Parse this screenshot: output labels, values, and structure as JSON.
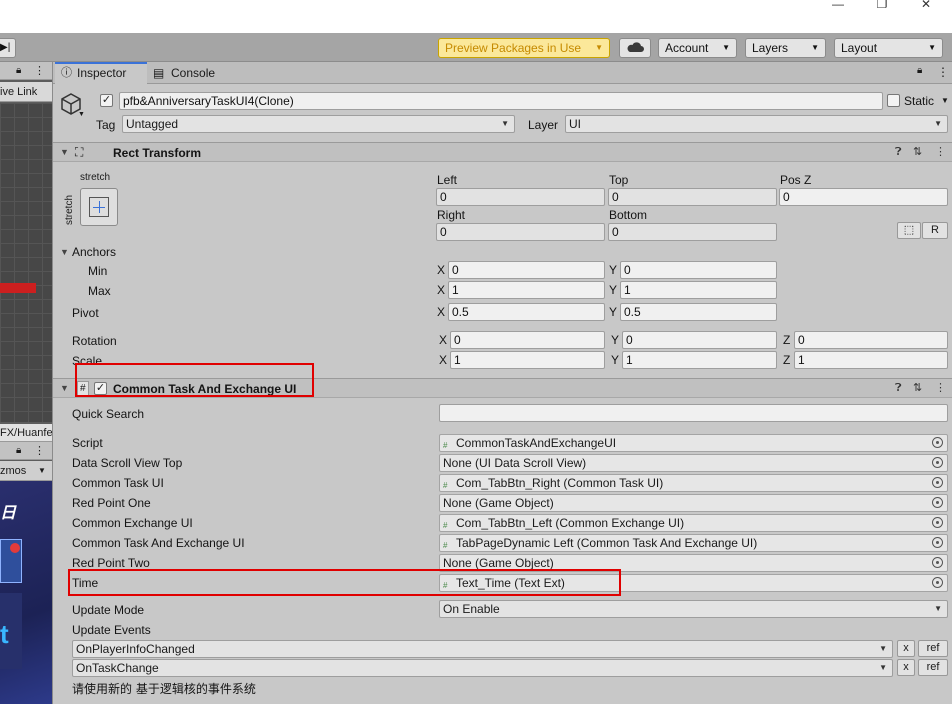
{
  "window": {
    "minimize_glyph": "—",
    "restore_glyph": "❐",
    "close_glyph": "✕"
  },
  "toolbar": {
    "play_glyph": "▶|",
    "preview_packages": "Preview Packages in Use",
    "cloud_icon": "cloud-icon",
    "account": "Account",
    "layers": "Layers",
    "layout": "Layout"
  },
  "left_panel": {
    "header1_text": "ive Link",
    "path_text": "FX/Huanfe",
    "gizmos_text": "zmos",
    "game_char": "日",
    "game_char2": "t"
  },
  "tabs": {
    "inspector": "Inspector",
    "console": "Console"
  },
  "object": {
    "name": "pfb&AnniversaryTaskUI4(Clone)",
    "static_label": "Static",
    "tag_label": "Tag",
    "tag_value": "Untagged",
    "layer_label": "Layer",
    "layer_value": "UI"
  },
  "rect_transform": {
    "title": "Rect Transform",
    "anchor_preset_h": "stretch",
    "anchor_preset_v": "stretch",
    "left_label": "Left",
    "left_value": "0",
    "top_label": "Top",
    "top_value": "0",
    "posz_label": "Pos Z",
    "posz_value": "0",
    "right_label": "Right",
    "right_value": "0",
    "bottom_label": "Bottom",
    "bottom_value": "0",
    "r_button": "R",
    "anchors_label": "Anchors",
    "min_label": "Min",
    "min_x": "0",
    "min_y": "0",
    "max_label": "Max",
    "max_x": "1",
    "max_y": "1",
    "pivot_label": "Pivot",
    "pivot_x": "0.5",
    "pivot_y": "0.5",
    "rotation_label": "Rotation",
    "rot_x": "0",
    "rot_y": "0",
    "rot_z": "0",
    "scale_label": "Scale",
    "scale_x": "1",
    "scale_y": "1",
    "scale_z": "1",
    "x": "X",
    "y": "Y",
    "z": "Z"
  },
  "component": {
    "title": "Common Task And Exchange UI",
    "hash": "#",
    "quick_search_label": "Quick Search",
    "quick_search_value": "",
    "fields": [
      {
        "label": "Script",
        "value": "CommonTaskAndExchangeUI",
        "icon": true
      },
      {
        "label": "Data Scroll View Top",
        "value": "None (UI Data Scroll View)",
        "icon": false
      },
      {
        "label": "Common Task UI",
        "value": "Com_TabBtn_Right (Common Task UI)",
        "icon": true
      },
      {
        "label": "Red Point One",
        "value": "None (Game Object)",
        "icon": false
      },
      {
        "label": "Common Exchange UI",
        "value": "Com_TabBtn_Left (Common Exchange UI)",
        "icon": true
      },
      {
        "label": "Common Task And Exchange UI",
        "value": "TabPageDynamic Left (Common Task And Exchange UI)",
        "icon": true
      },
      {
        "label": "Red Point Two",
        "value": "None (Game Object)",
        "icon": false
      },
      {
        "label": "Time",
        "value": "Text_Time (Text Ext)",
        "icon": true
      }
    ],
    "update_mode_label": "Update Mode",
    "update_mode_value": "On Enable",
    "update_events_label": "Update Events",
    "events": [
      {
        "value": "OnPlayerInfoChanged",
        "x": "x",
        "ref": "ref"
      },
      {
        "value": "OnTaskChange",
        "x": "x",
        "ref": "ref"
      }
    ],
    "note": "请使用新的 基于逻辑核的事件系统"
  },
  "colors": {
    "highlight": "#e00000",
    "accent": "#3a72d8",
    "preview": "#c58a00"
  }
}
